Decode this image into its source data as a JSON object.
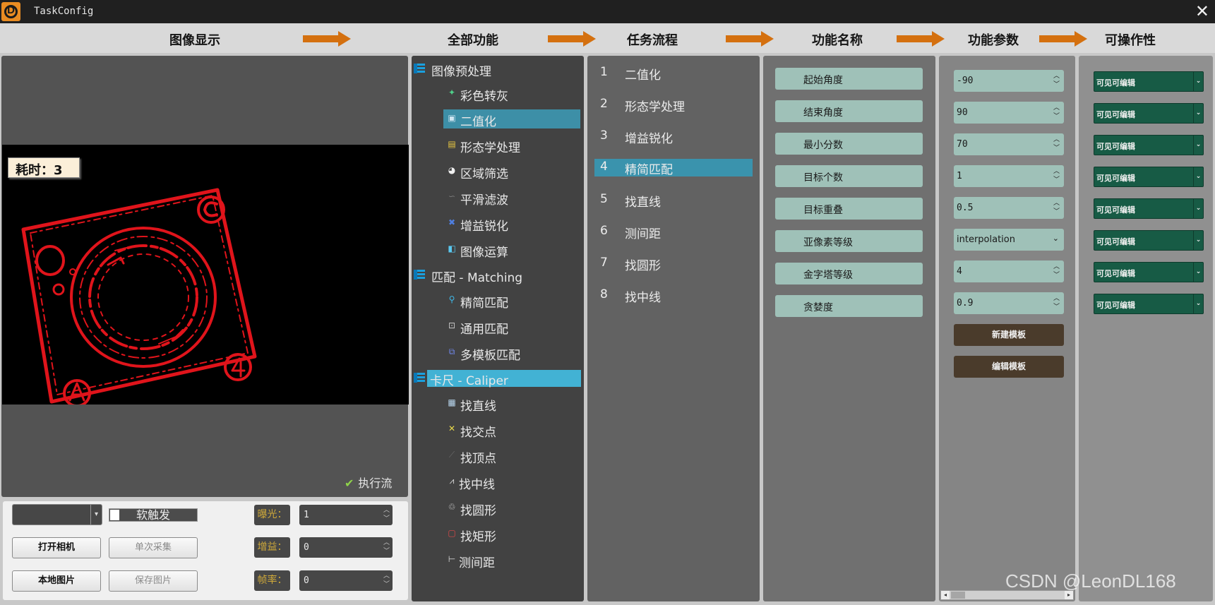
{
  "window": {
    "title": "TaskConfig",
    "close_icon": "close-icon"
  },
  "header": {
    "image_display": "图像显示",
    "all_functions": "全部功能",
    "task_flow": "任务流程",
    "function_name": "功能名称",
    "function_params": "功能参数",
    "operability": "可操作性",
    "arrow_color": "#d4700f"
  },
  "image_panel": {
    "time_label": "耗时：3",
    "exec_flow": "执行流",
    "exec_flow_checked": true
  },
  "camera": {
    "camera_select": "",
    "soft_trigger": "软触发",
    "open_camera": "打开相机",
    "single_capture": "单次采集",
    "local_image": "本地图片",
    "save_image": "保存图片",
    "exposure_label": "曝光：",
    "exposure_value": "1",
    "gain_label": "增益：",
    "gain_value": "0",
    "framerate_label": "帧率：",
    "framerate_value": "0"
  },
  "tree": {
    "categories": [
      {
        "label": "图像预处理",
        "selected": false,
        "items": [
          {
            "label": "彩色转灰",
            "icon": "color-to-gray-icon",
            "selected": false
          },
          {
            "label": "二值化",
            "icon": "binarize-icon",
            "selected": true
          },
          {
            "label": "形态学处理",
            "icon": "morphology-icon",
            "selected": false
          },
          {
            "label": "区域筛选",
            "icon": "region-filter-icon",
            "selected": false
          },
          {
            "label": "平滑滤波",
            "icon": "smooth-filter-icon",
            "selected": false
          },
          {
            "label": "增益锐化",
            "icon": "sharpen-icon",
            "selected": false
          },
          {
            "label": "图像运算",
            "icon": "image-arithmetic-icon",
            "selected": false
          }
        ]
      },
      {
        "label": "匹配 - Matching",
        "selected": false,
        "items": [
          {
            "label": "精简匹配",
            "icon": "search-icon",
            "selected": false
          },
          {
            "label": "通用匹配",
            "icon": "general-match-icon",
            "selected": false
          },
          {
            "label": "多模板匹配",
            "icon": "multi-template-icon",
            "selected": false
          }
        ]
      },
      {
        "label": "卡尺 - Caliper",
        "selected": true,
        "items": [
          {
            "label": "找直线",
            "icon": "find-line-icon",
            "selected": false
          },
          {
            "label": "找交点",
            "icon": "find-intersection-icon",
            "selected": false
          },
          {
            "label": "找顶点",
            "icon": "find-vertex-icon",
            "selected": false
          },
          {
            "label": "找中线",
            "icon": "find-midline-icon",
            "selected": false
          },
          {
            "label": "找圆形",
            "icon": "find-circle-icon",
            "selected": false
          },
          {
            "label": "找矩形",
            "icon": "find-rectangle-icon",
            "selected": false
          },
          {
            "label": "测间距",
            "icon": "measure-distance-icon",
            "selected": false
          }
        ]
      }
    ]
  },
  "flow": [
    {
      "num": "1",
      "label": "二值化",
      "selected": false
    },
    {
      "num": "2",
      "label": "形态学处理",
      "selected": false
    },
    {
      "num": "3",
      "label": "增益锐化",
      "selected": false
    },
    {
      "num": "4",
      "label": "精简匹配",
      "selected": true
    },
    {
      "num": "5",
      "label": "找直线",
      "selected": false
    },
    {
      "num": "6",
      "label": "测间距",
      "selected": false
    },
    {
      "num": "7",
      "label": "找圆形",
      "selected": false
    },
    {
      "num": "8",
      "label": "找中线",
      "selected": false
    }
  ],
  "names": [
    "起始角度",
    "结束角度",
    "最小分数",
    "目标个数",
    "目标重叠",
    "亚像素等级",
    "金字塔等级",
    "贪婪度"
  ],
  "params": [
    {
      "type": "spin",
      "value": "-90"
    },
    {
      "type": "spin",
      "value": "90"
    },
    {
      "type": "spin",
      "value": "70"
    },
    {
      "type": "spin",
      "value": "1"
    },
    {
      "type": "spin",
      "value": "0.5"
    },
    {
      "type": "select",
      "value": "interpolation"
    },
    {
      "type": "spin",
      "value": "4"
    },
    {
      "type": "spin",
      "value": "0.9"
    }
  ],
  "param_buttons": {
    "new_template": "新建模板",
    "edit_template": "编辑模板"
  },
  "operability": [
    "可见可编辑",
    "可见可编辑",
    "可见可编辑",
    "可见可编辑",
    "可见可编辑",
    "可见可编辑",
    "可见可编辑",
    "可见可编辑"
  ],
  "watermark": "CSDN @LeonDL168",
  "colors": {
    "tree_selected": "#3d8fa7",
    "category_selected": "#42b2d4",
    "flow_selected": "#3a93ad",
    "param_bg": "#9fc1b8",
    "oper_bg": "#175b45",
    "button_brown": "#4a3b2b",
    "edge_red": "#e0141b"
  }
}
